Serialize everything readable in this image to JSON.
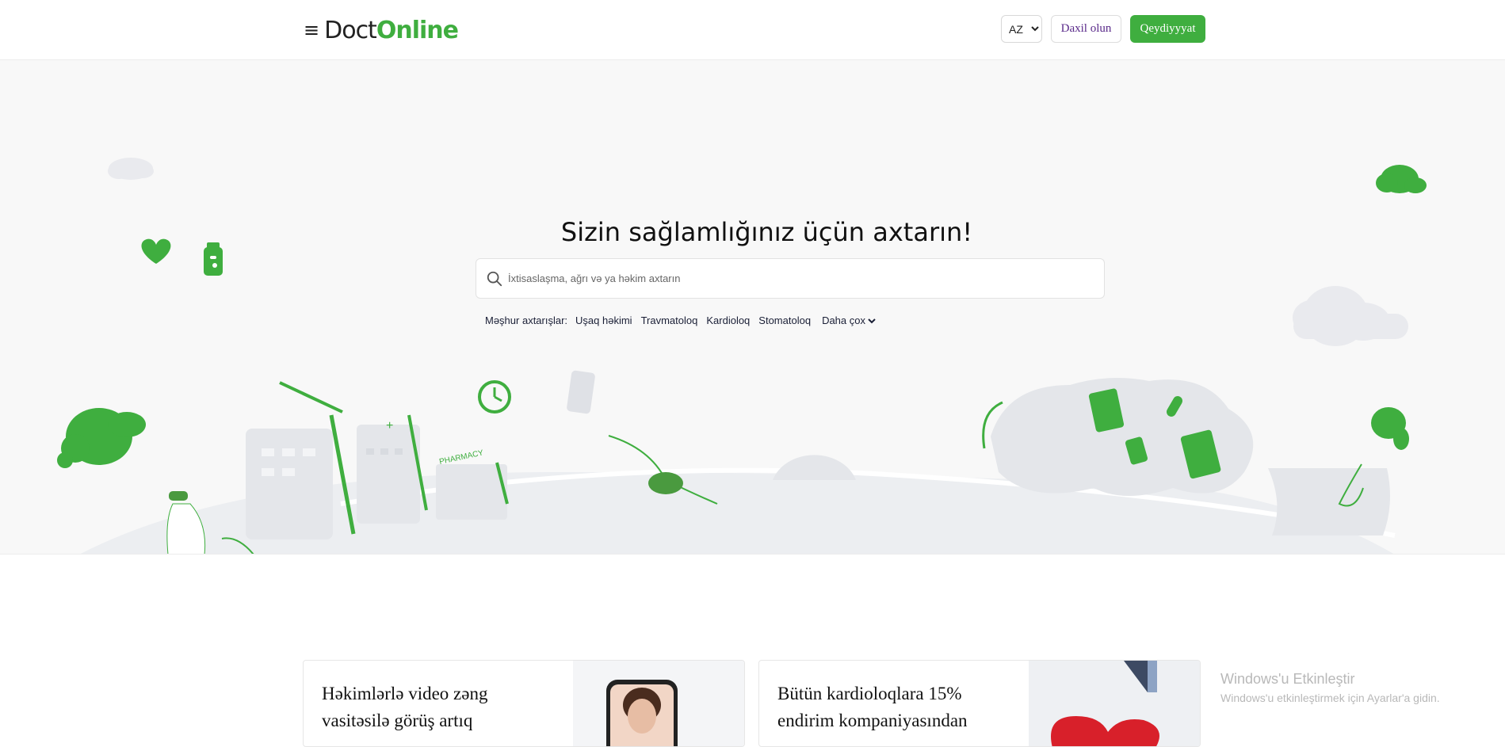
{
  "header": {
    "menu_icon": "≡",
    "logo_part1": "Doct",
    "logo_part2": "Online",
    "language": "AZ",
    "login_label": "Daxil olun",
    "register_label": "Qeydiyyyat"
  },
  "hero": {
    "title": "Sizin sağlamlığınız üçün axtarın!",
    "search_placeholder": "İxtisaslaşma, ağrı və ya həkim axtarın",
    "popular_label": "Məşhur axtarışlar:",
    "popular_items": [
      "Uşaq həkimi",
      "Travmatoloq",
      "Kardioloq",
      "Stomatoloq"
    ],
    "more_label": "Daha çox",
    "pharmacy_sign": "PHARMACY"
  },
  "cards": [
    {
      "title": "Həkimlərlə video zəng vasitəsilə görüş artıq"
    },
    {
      "title": "Bütün kardioloqlara 15% endirim kompaniyasından"
    }
  ],
  "watermark": {
    "title": "Windows'u Etkinleştir",
    "subtitle": "Windows'u etkinleştirmek için Ayarlar'a gidin."
  },
  "colors": {
    "brand_green": "#3fae3f",
    "login_text": "#5a2a8a",
    "hero_bg": "#f8f8f8"
  },
  "icons": [
    "menu-icon",
    "search-icon",
    "chevron-down-icon",
    "heart-icon",
    "pill-bottle-icon",
    "clock-icon",
    "cloud-icon"
  ]
}
